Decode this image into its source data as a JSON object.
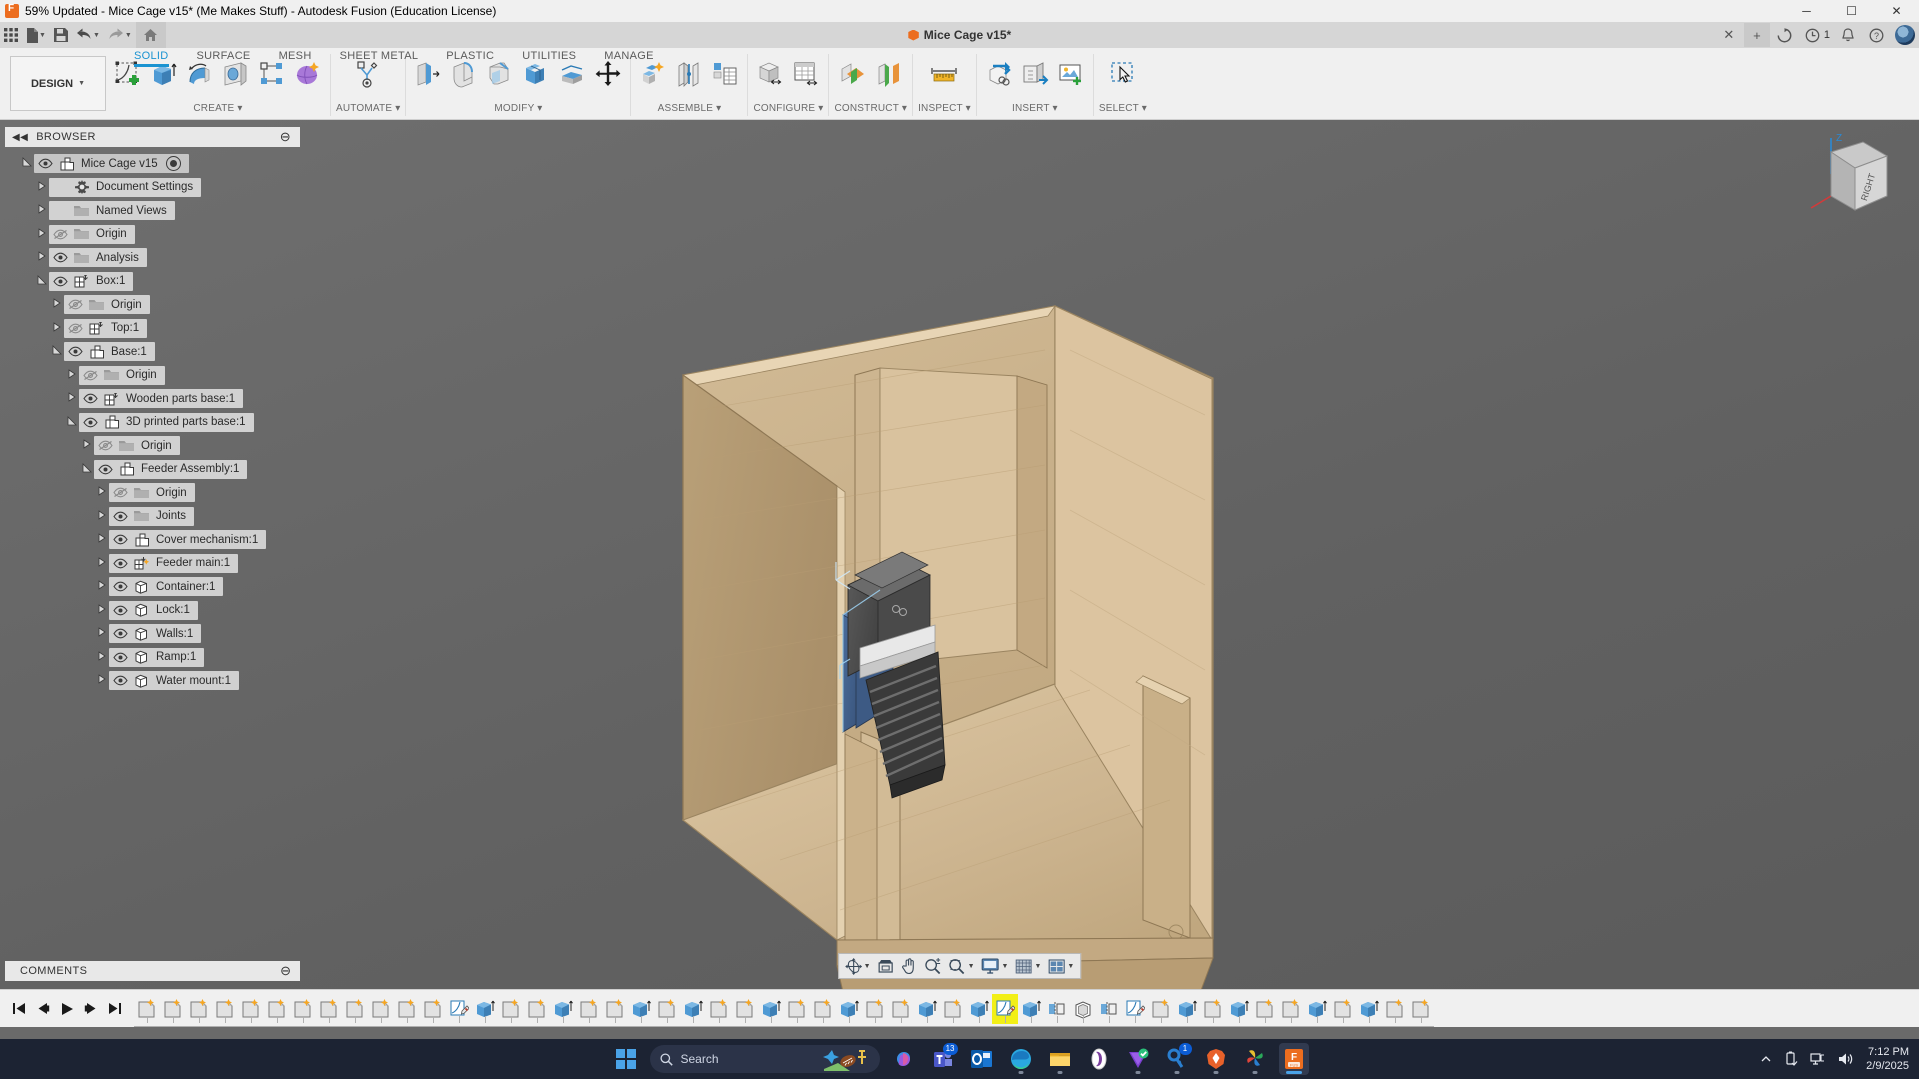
{
  "window": {
    "title": "59% Updated - Mice Cage v15* (Me Makes Stuff) - Autodesk Fusion (Education License)",
    "app_icon": "fusion-icon",
    "minimize": "─",
    "maximize": "☐",
    "close": "✕"
  },
  "quick_access": {
    "items": [
      {
        "name": "app-grid-icon",
        "glyph": "grid"
      },
      {
        "name": "new-file-icon",
        "glyph": "file",
        "caret": true
      },
      {
        "name": "save-icon",
        "glyph": "save"
      },
      {
        "name": "undo-icon",
        "glyph": "undo",
        "caret": true
      },
      {
        "name": "redo-icon",
        "glyph": "redo",
        "caret": true
      },
      {
        "name": "home-icon",
        "glyph": "home"
      }
    ]
  },
  "document_tab": {
    "label": "Mice Cage v15*",
    "close": "✕",
    "new_tab": "+"
  },
  "tab_right": {
    "refresh": "refresh-icon",
    "job_status": "job-status-icon",
    "job_count": "1",
    "notifications": "bell-icon",
    "help": "help-icon",
    "avatar": "user-avatar"
  },
  "ribbon": {
    "design_label": "DESIGN",
    "tabs": [
      {
        "label": "SOLID",
        "active": true
      },
      {
        "label": "SURFACE",
        "active": false
      },
      {
        "label": "MESH",
        "active": false
      },
      {
        "label": "SHEET METAL",
        "active": false
      },
      {
        "label": "PLASTIC",
        "active": false
      },
      {
        "label": "UTILITIES",
        "active": false
      },
      {
        "label": "MANAGE",
        "active": false
      }
    ],
    "panels": [
      {
        "label": "CREATE",
        "tools": [
          "sketch-icon",
          "extrude-icon",
          "revolve-icon",
          "hole-icon",
          "rib-icon",
          "form-icon"
        ]
      },
      {
        "label": "AUTOMATE",
        "tools": [
          "automate-icon"
        ]
      },
      {
        "label": "MODIFY",
        "tools": [
          "press-pull-icon",
          "fillet-icon",
          "chamfer-icon",
          "shell-icon",
          "offset-face-icon",
          "move-copy-icon"
        ]
      },
      {
        "label": "ASSEMBLE",
        "tools": [
          "new-component-icon",
          "joint-icon",
          "joint-origin-icon"
        ]
      },
      {
        "label": "CONFIGURE",
        "tools": [
          "configuration-icon",
          "config-table-icon"
        ]
      },
      {
        "label": "CONSTRUCT",
        "tools": [
          "offset-plane-icon",
          "plane-at-angle-icon"
        ]
      },
      {
        "label": "INSPECT",
        "tools": [
          "measure-icon"
        ]
      },
      {
        "label": "INSERT",
        "tools": [
          "insert-derive-icon",
          "insert-mcmaster-icon",
          "decal-icon"
        ]
      },
      {
        "label": "SELECT",
        "tools": [
          "select-icon"
        ]
      }
    ]
  },
  "browser": {
    "title": "BROWSER",
    "collapse": "◀◀",
    "minimize": "⊖",
    "tree": [
      {
        "label": "Mice Cage v15",
        "indent": 0,
        "arrow": "open",
        "eye": "visible",
        "icon": "component-icon",
        "root": true
      },
      {
        "label": "Document Settings",
        "indent": 1,
        "arrow": "closed",
        "eye": "none",
        "icon": "gear-icon"
      },
      {
        "label": "Named Views",
        "indent": 1,
        "arrow": "closed",
        "eye": "none",
        "icon": "folder-icon"
      },
      {
        "label": "Origin",
        "indent": 1,
        "arrow": "closed",
        "eye": "hidden",
        "icon": "folder-icon"
      },
      {
        "label": "Analysis",
        "indent": 1,
        "arrow": "closed",
        "eye": "visible",
        "icon": "folder-icon"
      },
      {
        "label": "Box:1",
        "indent": 1,
        "arrow": "open",
        "eye": "visible",
        "icon": "component-joint-icon"
      },
      {
        "label": "Origin",
        "indent": 2,
        "arrow": "closed",
        "eye": "hidden",
        "icon": "folder-icon"
      },
      {
        "label": "Top:1",
        "indent": 2,
        "arrow": "closed",
        "eye": "hidden",
        "icon": "component-joint-icon"
      },
      {
        "label": "Base:1",
        "indent": 2,
        "arrow": "open",
        "eye": "visible",
        "icon": "component-icon"
      },
      {
        "label": "Origin",
        "indent": 3,
        "arrow": "closed",
        "eye": "hidden",
        "icon": "folder-icon"
      },
      {
        "label": "Wooden parts base:1",
        "indent": 3,
        "arrow": "closed",
        "eye": "visible",
        "icon": "component-joint-icon"
      },
      {
        "label": "3D printed parts base:1",
        "indent": 3,
        "arrow": "open",
        "eye": "visible",
        "icon": "component-icon"
      },
      {
        "label": "Origin",
        "indent": 4,
        "arrow": "closed",
        "eye": "hidden",
        "icon": "folder-icon"
      },
      {
        "label": "Feeder Assembly:1",
        "indent": 4,
        "arrow": "open",
        "eye": "visible",
        "icon": "component-icon"
      },
      {
        "label": "Origin",
        "indent": 5,
        "arrow": "closed",
        "eye": "hidden",
        "icon": "folder-icon"
      },
      {
        "label": "Joints",
        "indent": 5,
        "arrow": "closed",
        "eye": "visible",
        "icon": "folder-icon"
      },
      {
        "label": "Cover mechanism:1",
        "indent": 5,
        "arrow": "closed",
        "eye": "visible",
        "icon": "component-icon"
      },
      {
        "label": "Feeder main:1",
        "indent": 5,
        "arrow": "closed",
        "eye": "visible",
        "icon": "component-joint-star-icon"
      },
      {
        "label": "Container:1",
        "indent": 5,
        "arrow": "closed",
        "eye": "visible",
        "icon": "body-icon"
      },
      {
        "label": "Lock:1",
        "indent": 5,
        "arrow": "closed",
        "eye": "visible",
        "icon": "body-icon"
      },
      {
        "label": "Walls:1",
        "indent": 5,
        "arrow": "closed",
        "eye": "visible",
        "icon": "body-icon"
      },
      {
        "label": "Ramp:1",
        "indent": 5,
        "arrow": "closed",
        "eye": "visible",
        "icon": "body-icon"
      },
      {
        "label": "Water mount:1",
        "indent": 5,
        "arrow": "closed",
        "eye": "visible",
        "icon": "body-icon"
      }
    ]
  },
  "viewcube": {
    "face_label": "RIGHT",
    "axis_z": "Z"
  },
  "navbar": {
    "items": [
      {
        "name": "orbit-icon",
        "caret": true
      },
      {
        "name": "look-at-icon",
        "caret": false
      },
      {
        "name": "pan-icon",
        "caret": false
      },
      {
        "name": "zoom-icon",
        "caret": false
      },
      {
        "name": "fit-icon",
        "caret": true
      },
      {
        "name": "display-settings-icon",
        "caret": true
      },
      {
        "name": "grid-snaps-icon",
        "caret": true
      },
      {
        "name": "viewports-icon",
        "caret": true
      }
    ]
  },
  "comments": {
    "title": "COMMENTS",
    "minimize": "⊖"
  },
  "timeline": {
    "controls": [
      {
        "name": "go-to-beginning-button",
        "glyph": "first"
      },
      {
        "name": "step-back-button",
        "glyph": "prev"
      },
      {
        "name": "play-button",
        "glyph": "play"
      },
      {
        "name": "step-forward-button",
        "glyph": "next"
      },
      {
        "name": "go-to-end-button",
        "glyph": "last"
      }
    ],
    "features": [
      {
        "icon": "sketch-feature-icon",
        "selected": false
      },
      {
        "icon": "sketch-feature-icon",
        "selected": false
      },
      {
        "icon": "sketch-feature-icon",
        "selected": false
      },
      {
        "icon": "sketch-feature-icon",
        "selected": false
      },
      {
        "icon": "sketch-feature-icon",
        "selected": false
      },
      {
        "icon": "sketch-feature-icon",
        "selected": false
      },
      {
        "icon": "sketch-feature-icon",
        "selected": false
      },
      {
        "icon": "sketch-feature-icon",
        "selected": false
      },
      {
        "icon": "sketch-feature-icon",
        "selected": false
      },
      {
        "icon": "sketch-feature-icon",
        "selected": false
      },
      {
        "icon": "sketch-feature-icon",
        "selected": false
      },
      {
        "icon": "sketch-feature-icon",
        "selected": false
      },
      {
        "icon": "sketch-icon-feature",
        "selected": false
      },
      {
        "icon": "extrude-feature-icon",
        "selected": false
      },
      {
        "icon": "sketch-feature-icon",
        "selected": false
      },
      {
        "icon": "sketch-feature-icon",
        "selected": false
      },
      {
        "icon": "extrude-feature-icon",
        "selected": false
      },
      {
        "icon": "sketch-feature-icon",
        "selected": false
      },
      {
        "icon": "sketch-feature-icon",
        "selected": false
      },
      {
        "icon": "extrude-feature-icon",
        "selected": false
      },
      {
        "icon": "sketch-feature-icon",
        "selected": false
      },
      {
        "icon": "extrude-feature-icon",
        "selected": false
      },
      {
        "icon": "sketch-feature-icon",
        "selected": false
      },
      {
        "icon": "sketch-feature-icon",
        "selected": false
      },
      {
        "icon": "extrude-feature-icon",
        "selected": false
      },
      {
        "icon": "sketch-feature-icon",
        "selected": false
      },
      {
        "icon": "sketch-feature-icon",
        "selected": false
      },
      {
        "icon": "extrude-feature-icon",
        "selected": false
      },
      {
        "icon": "sketch-feature-icon",
        "selected": false
      },
      {
        "icon": "sketch-feature-icon",
        "selected": false
      },
      {
        "icon": "extrude-feature-icon",
        "selected": false
      },
      {
        "icon": "sketch-feature-icon",
        "selected": false
      },
      {
        "icon": "extrude-feature-icon",
        "selected": false
      },
      {
        "icon": "sketch-icon-feature",
        "selected": true
      },
      {
        "icon": "extrude-feature-icon",
        "selected": false
      },
      {
        "icon": "mirror-feature-icon",
        "selected": false
      },
      {
        "icon": "shell-feature-icon",
        "selected": false
      },
      {
        "icon": "mirror-feature-icon",
        "selected": false
      },
      {
        "icon": "sketch-icon-feature",
        "selected": false
      },
      {
        "icon": "sketch-feature-icon",
        "selected": false
      },
      {
        "icon": "extrude-feature-icon",
        "selected": false
      },
      {
        "icon": "sketch-feature-icon",
        "selected": false
      },
      {
        "icon": "extrude-feature-icon",
        "selected": false
      },
      {
        "icon": "sketch-feature-icon",
        "selected": false
      },
      {
        "icon": "sketch-feature-icon",
        "selected": false
      },
      {
        "icon": "extrude-feature-icon",
        "selected": false
      },
      {
        "icon": "sketch-feature-icon",
        "selected": false
      },
      {
        "icon": "extrude-feature-icon",
        "selected": false
      },
      {
        "icon": "sketch-feature-icon",
        "selected": false
      },
      {
        "icon": "sketch-feature-icon",
        "selected": false
      }
    ]
  },
  "taskbar": {
    "start": "windows-start-icon",
    "search_placeholder": "Search",
    "apps": [
      {
        "name": "copilot-icon",
        "badge": null,
        "running": false
      },
      {
        "name": "teams-icon",
        "badge": "13",
        "running": false
      },
      {
        "name": "outlook-icon",
        "badge": null,
        "running": false
      },
      {
        "name": "edge-icon",
        "badge": null,
        "running": true
      },
      {
        "name": "file-explorer-icon",
        "badge": null,
        "running": true
      },
      {
        "name": "onenote-icon",
        "badge": null,
        "running": false
      },
      {
        "name": "vector-icon",
        "badge": null,
        "running": true
      },
      {
        "name": "key-icon",
        "badge": "1",
        "running": true
      },
      {
        "name": "brave-icon",
        "badge": null,
        "running": true
      },
      {
        "name": "photos-icon",
        "badge": null,
        "running": true
      },
      {
        "name": "fusion-icon",
        "badge": null,
        "running": true
      }
    ],
    "tray": {
      "chevron": "show-hidden-icons",
      "usb": "usb-icon",
      "network": "network-icon",
      "volume": "volume-icon",
      "time": "7:12 PM",
      "date": "2/9/2025"
    }
  }
}
